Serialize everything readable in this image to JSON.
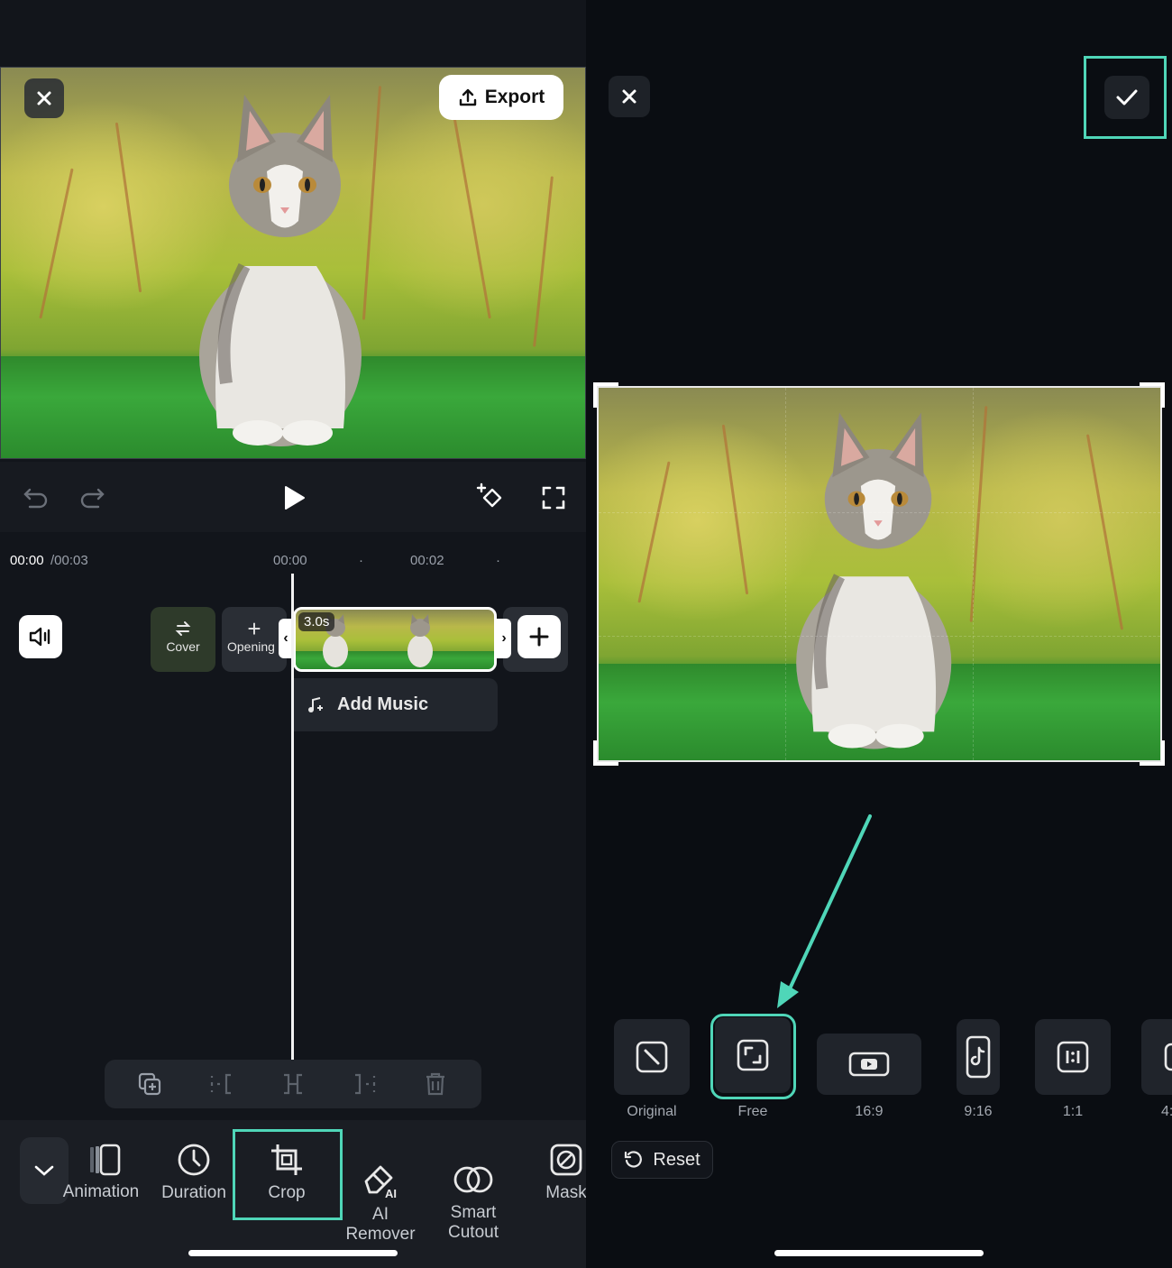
{
  "left": {
    "export_label": "Export",
    "time_current": "00:00",
    "time_total": "/00:03",
    "ruler_marks": [
      "00:00",
      "00:02"
    ],
    "clip_duration": "3.0s",
    "cover_label": "Cover",
    "opening_label": "Opening",
    "add_music_label": "Add Music",
    "tools": [
      {
        "label": "Animation",
        "icon": "animation-icon"
      },
      {
        "label": "Duration",
        "icon": "clock-icon"
      },
      {
        "label": "Crop",
        "icon": "crop-icon"
      },
      {
        "label": "AI\nRemover",
        "icon": "ai-remover-icon"
      },
      {
        "label": "Smart\nCutout",
        "icon": "smart-cutout-icon"
      },
      {
        "label": "Mask",
        "icon": "mask-icon"
      }
    ],
    "accent_color": "#4fd6b8"
  },
  "right": {
    "ratios": [
      {
        "label": "Original",
        "icon": "original-icon"
      },
      {
        "label": "Free",
        "icon": "free-crop-icon",
        "selected": true
      },
      {
        "label": "16:9",
        "icon": "youtube-icon"
      },
      {
        "label": "9:16",
        "icon": "tiktok-icon"
      },
      {
        "label": "1:1",
        "icon": "square-ratio-icon"
      },
      {
        "label": "4:",
        "icon": "ratio-icon"
      }
    ],
    "reset_label": "Reset"
  }
}
